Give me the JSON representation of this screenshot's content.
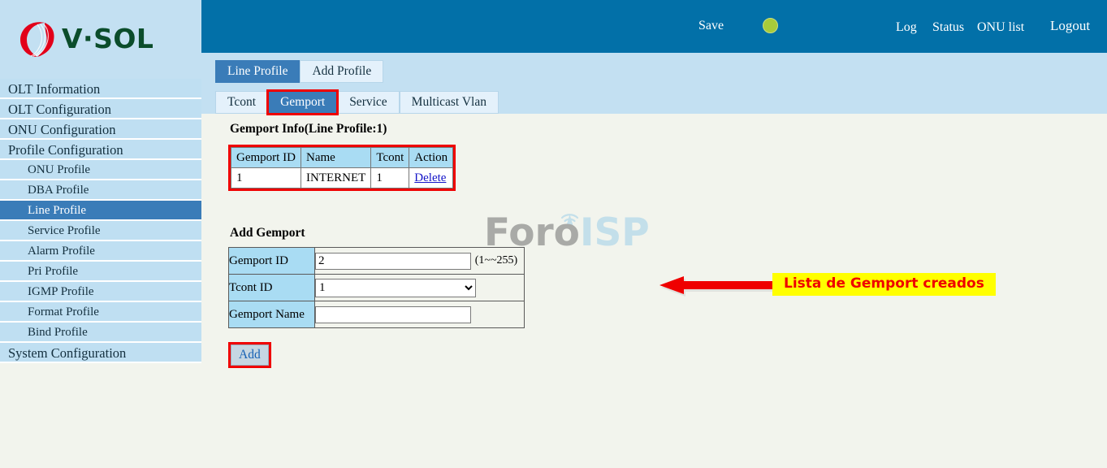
{
  "brand": {
    "name": "V·SOL",
    "logo_icon": "vsol-flame-logo"
  },
  "header": {
    "save_label": "Save",
    "status_dot": {
      "icon": "status-indicator-circle",
      "color": "#a8cb3a"
    },
    "links": [
      {
        "label": "Log"
      },
      {
        "label": "Status"
      },
      {
        "label": "ONU list"
      },
      {
        "label": "Logout"
      }
    ]
  },
  "sidebar": {
    "items": [
      {
        "label": "OLT Information",
        "level": "top",
        "selected": false
      },
      {
        "label": "OLT Configuration",
        "level": "top",
        "selected": false
      },
      {
        "label": "ONU Configuration",
        "level": "top",
        "selected": false
      },
      {
        "label": "Profile Configuration",
        "level": "top",
        "selected": false
      },
      {
        "label": "ONU Profile",
        "level": "sub",
        "selected": false
      },
      {
        "label": "DBA Profile",
        "level": "sub",
        "selected": false
      },
      {
        "label": "Line Profile",
        "level": "sub",
        "selected": true
      },
      {
        "label": "Service Profile",
        "level": "sub",
        "selected": false
      },
      {
        "label": "Alarm Profile",
        "level": "sub",
        "selected": false
      },
      {
        "label": "Pri Profile",
        "level": "sub",
        "selected": false
      },
      {
        "label": "IGMP Profile",
        "level": "sub",
        "selected": false
      },
      {
        "label": "Format Profile",
        "level": "sub",
        "selected": false
      },
      {
        "label": "Bind Profile",
        "level": "sub",
        "selected": false
      },
      {
        "label": "System Configuration",
        "level": "top",
        "selected": false
      }
    ]
  },
  "tabs_primary": [
    {
      "label": "Line Profile",
      "active": true
    },
    {
      "label": "Add Profile",
      "active": false
    }
  ],
  "tabs_secondary": [
    {
      "label": "Tcont",
      "active": false,
      "highlighted": false
    },
    {
      "label": "Gemport",
      "active": true,
      "highlighted": true
    },
    {
      "label": "Service",
      "active": false,
      "highlighted": false
    },
    {
      "label": "Multicast Vlan",
      "active": false,
      "highlighted": false
    }
  ],
  "gemport_info": {
    "title": "Gemport Info(Line Profile:1)",
    "columns": [
      "Gemport ID",
      "Name",
      "Tcont",
      "Action"
    ],
    "rows": [
      {
        "gemport_id": "1",
        "name": "INTERNET",
        "tcont": "1",
        "action": "Delete"
      }
    ]
  },
  "annotation": {
    "text": "Lista de Gemport creados",
    "text_color": "#ef0000",
    "background": "#ffff00",
    "arrow_icon": "left-arrow-annotation",
    "arrow_color": "#ef0000"
  },
  "add_gemport": {
    "title": "Add Gemport",
    "fields": [
      {
        "label": "Gemport ID",
        "value": "2",
        "placeholder": "",
        "hint": "(1~~255)",
        "type": "text"
      },
      {
        "label": "Tcont ID",
        "value": "1",
        "type": "select",
        "options": [
          "1"
        ]
      },
      {
        "label": "Gemport Name",
        "value": "",
        "placeholder": "",
        "type": "text"
      }
    ],
    "submit_label": "Add"
  },
  "watermark": {
    "part_a": "Foro",
    "part_b": "ISP",
    "icon": "antenna-tower-icon"
  }
}
